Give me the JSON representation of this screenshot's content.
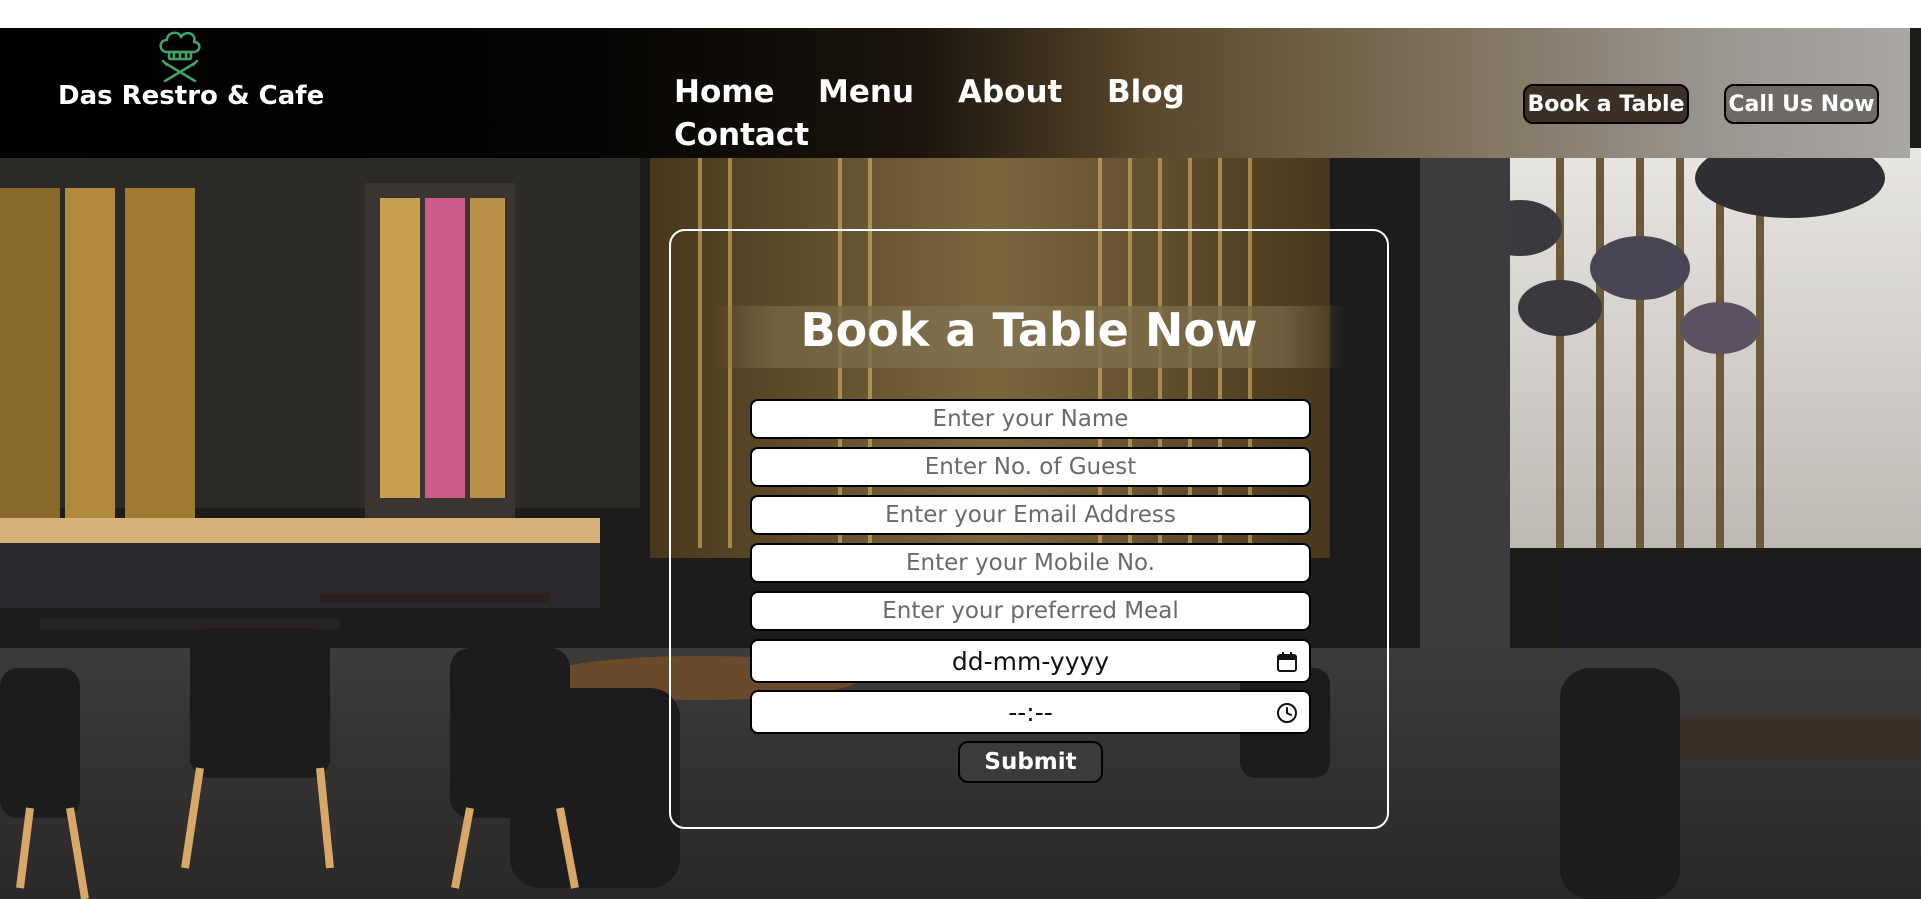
{
  "brand": {
    "name": "Das Restro & Cafe",
    "logo_icon": "chef-hat-crossed-utensils-icon",
    "logo_color": "#3fa36a"
  },
  "nav": {
    "links": [
      "Home",
      "Menu",
      "About",
      "Blog",
      "Contact"
    ],
    "book_button": "Book a Table",
    "call_button": "Call Us Now"
  },
  "booking": {
    "title": "Book a Table Now",
    "fields": {
      "name_placeholder": "Enter your Name",
      "guests_placeholder": "Enter No. of Guest",
      "email_placeholder": "Enter your Email Address",
      "mobile_placeholder": "Enter your Mobile No.",
      "meal_placeholder": "Enter your preferred Meal",
      "date_value": "dd-mm-yyyy",
      "time_value": "--:--"
    },
    "date_icon": "calendar-icon",
    "time_icon": "clock-icon",
    "submit_label": "Submit"
  },
  "colors": {
    "text_primary": "#ffffff",
    "submit_bg": "#3b3b3b",
    "border": "#000000"
  }
}
